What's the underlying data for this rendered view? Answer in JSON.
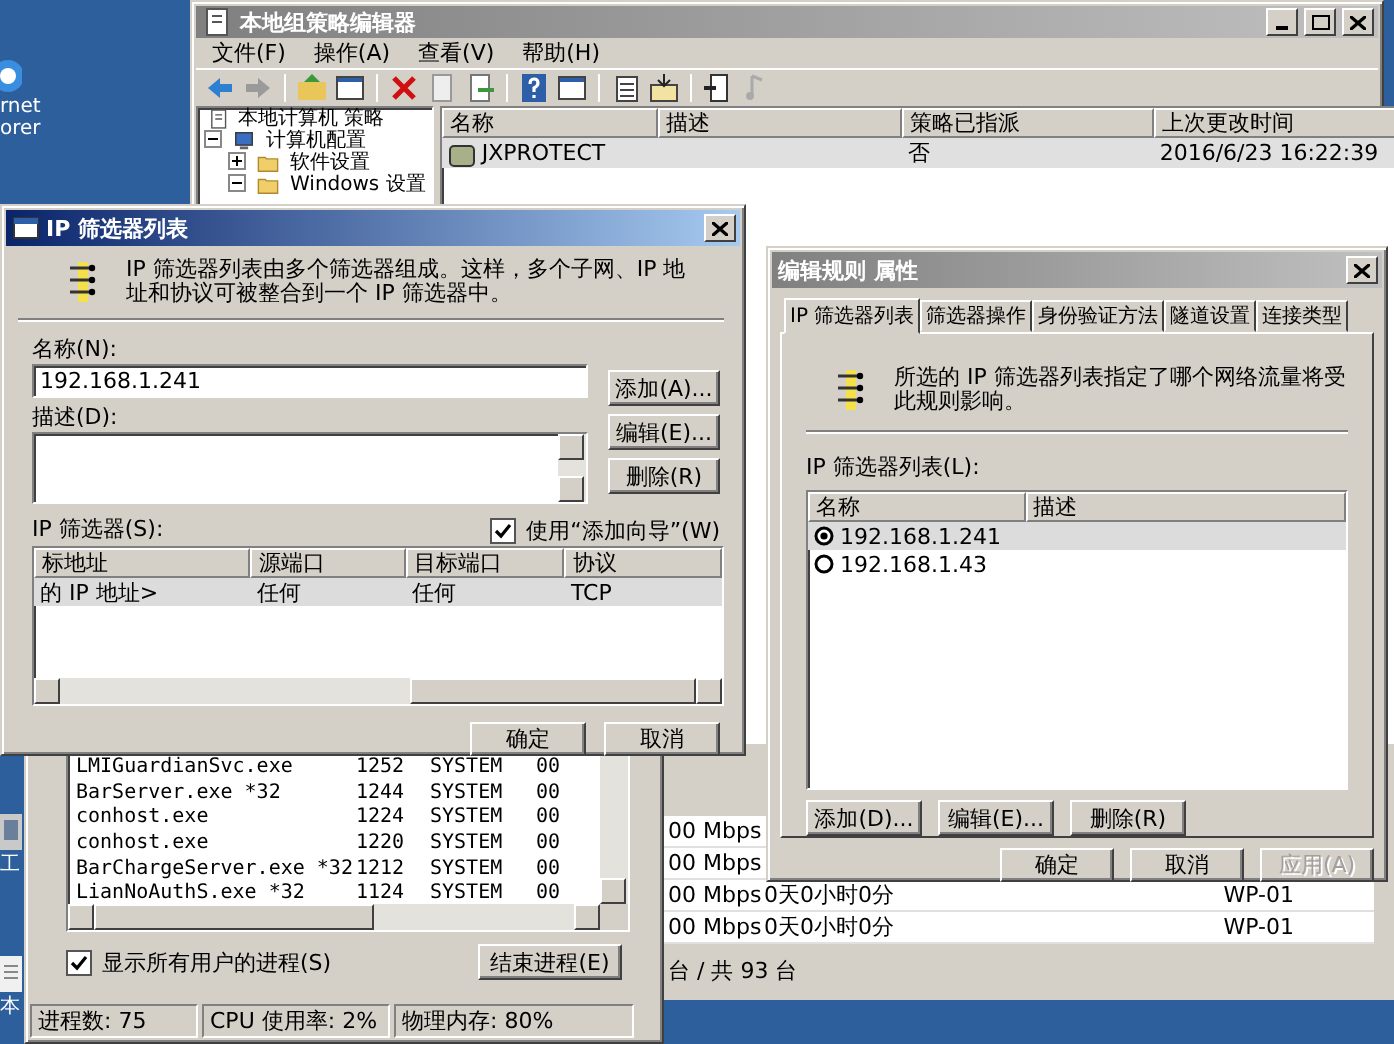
{
  "desktop_icons": [
    {
      "label": "rnet orer"
    },
    {
      "label": "工"
    },
    {
      "label": "本"
    }
  ],
  "policy_editor": {
    "title": "本地组策略编辑器",
    "menu": [
      "文件(F)",
      "操作(A)",
      "查看(V)",
      "帮助(H)"
    ],
    "tree": {
      "root": "本地计算机 策略",
      "items": [
        {
          "label": "计算机配置",
          "expanded": true,
          "children": [
            {
              "label": "软件设置",
              "expanded": false
            },
            {
              "label": "Windows 设置",
              "expanded": true
            }
          ]
        }
      ]
    },
    "columns": [
      "名称",
      "描述",
      "策略已指派",
      "上次更改时间"
    ],
    "rows": [
      {
        "cells": [
          "JXPROTECT",
          "",
          "否",
          "2016/6/23 16:22:39"
        ],
        "selected": true
      }
    ]
  },
  "background_list": {
    "rows": [
      {
        "column_1": "00 Mbps",
        "column_2": "",
        "column_3": ""
      },
      {
        "column_1": "00 Mbps",
        "column_2": "",
        "column_3": ""
      },
      {
        "column_1": "00 Mbps",
        "column_2": "0天0小时0分",
        "column_3": "WP-01"
      },
      {
        "column_1": "00 Mbps",
        "column_2": "0天0小时0分",
        "column_3": "WP-01"
      }
    ],
    "footer": "台 / 共 93 台"
  },
  "task_manager": {
    "processes": [
      {
        "name": "LMIGuardianSvc.exe",
        "pid": "1252",
        "user": "SYSTEM",
        "cpu": "00"
      },
      {
        "name": "BarServer.exe *32",
        "pid": "1244",
        "user": "SYSTEM",
        "cpu": "00"
      },
      {
        "name": "conhost.exe",
        "pid": "1224",
        "user": "SYSTEM",
        "cpu": "00"
      },
      {
        "name": "conhost.exe",
        "pid": "1220",
        "user": "SYSTEM",
        "cpu": "00"
      },
      {
        "name": "BarChargeServer.exe *32",
        "pid": "1212",
        "user": "SYSTEM",
        "cpu": "00"
      },
      {
        "name": "LianNoAuthS.exe *32",
        "pid": "1124",
        "user": "SYSTEM",
        "cpu": "00"
      }
    ],
    "show_all_users": {
      "label": "显示所有用户的进程(S)",
      "checked": true
    },
    "end_process_button": "结束进程(E)",
    "status_bar": [
      "进程数: 75",
      "CPU 使用率: 2%",
      "物理内存: 80%"
    ]
  },
  "ip_filter_list_dialog": {
    "title": "IP 筛选器列表",
    "description": "IP 筛选器列表由多个筛选器组成。这样，多个子网、IP 地址和协议可被整合到一个 IP 筛选器中。",
    "name_label": "名称(N):",
    "name_value": "192.168.1.241",
    "description_label": "描述(D):",
    "side_buttons": [
      "添加(A)...",
      "编辑(E)...",
      "删除(R)"
    ],
    "filters_label": "IP 筛选器(S):",
    "use_wizard": {
      "label": "使用“添加向导”(W)",
      "checked": true
    },
    "columns": [
      "标地址",
      "源端口",
      "目标端口",
      "协议"
    ],
    "rows": [
      {
        "cells": [
          "的 IP 地址>",
          "任何",
          "任何",
          "TCP"
        ],
        "selected": true
      }
    ],
    "buttons": [
      "确定",
      "取消"
    ]
  },
  "rule_properties_dialog": {
    "title": "编辑规则 属性",
    "tabs": [
      {
        "label": "IP 筛选器列表",
        "selected": true
      },
      {
        "label": "筛选器操作",
        "selected": false
      },
      {
        "label": "身份验证方法",
        "selected": false
      },
      {
        "label": "隧道设置",
        "selected": false
      },
      {
        "label": "连接类型",
        "selected": false
      }
    ],
    "description": "所选的 IP 筛选器列表指定了哪个网络流量将受此规则影响。",
    "list_label": "IP 筛选器列表(L):",
    "columns": [
      "名称",
      "描述"
    ],
    "items": [
      {
        "label": "192.168.1.241",
        "selected": true
      },
      {
        "label": "192.168.1.43",
        "selected": false
      }
    ],
    "list_buttons": [
      "添加(D)...",
      "编辑(E)...",
      "删除(R)"
    ],
    "buttons": [
      {
        "label": "确定",
        "disabled": false
      },
      {
        "label": "取消",
        "disabled": false
      },
      {
        "label": "应用(A)",
        "disabled": true
      }
    ]
  }
}
